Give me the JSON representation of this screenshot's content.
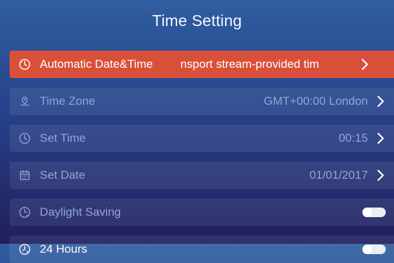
{
  "header": {
    "title": "Time Setting"
  },
  "rows": [
    {
      "label": "Automatic Date&Time",
      "value": "nsport stream-provided tim",
      "icon": "auto-clock-icon",
      "selected": true
    },
    {
      "label": "Time Zone",
      "value": "GMT+00:00 London",
      "icon": "location-pin-icon"
    },
    {
      "label": "Set Time",
      "value": "00:15",
      "icon": "clock-icon"
    },
    {
      "label": "Set Date",
      "value": "01/01/2017",
      "icon": "calendar-icon"
    },
    {
      "label": "Daylight Saving",
      "icon": "daylight-clock-icon",
      "toggle": "off"
    },
    {
      "label": "24 Hours",
      "icon": "24h-clock-icon",
      "toggle": "off"
    }
  ],
  "colors": {
    "selected_row": "#d9503a",
    "row_text": "#8fa6d6",
    "title_text": "#f3f6ff"
  }
}
